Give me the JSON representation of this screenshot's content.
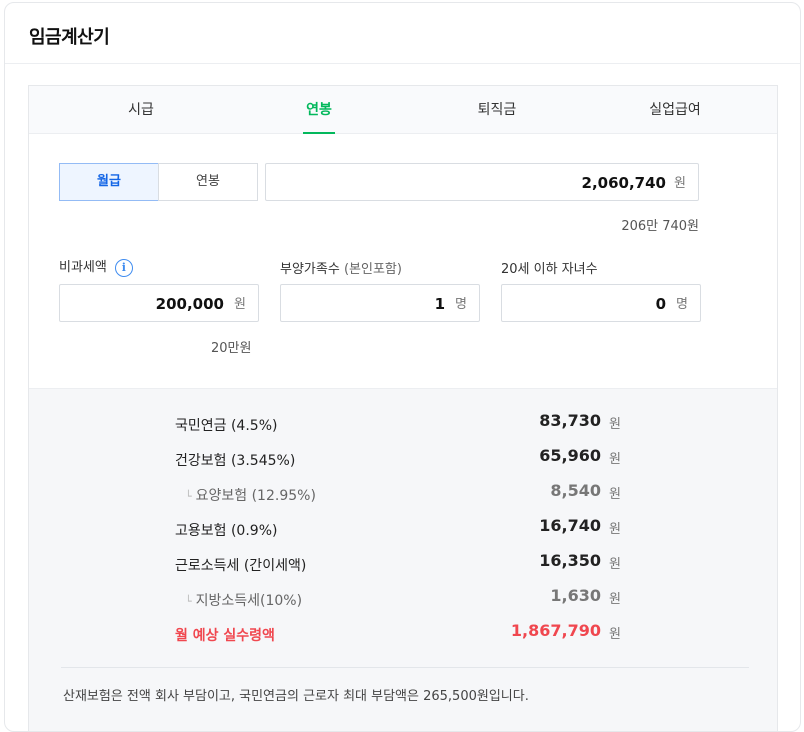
{
  "title": "임금계산기",
  "tabs": [
    {
      "label": "시급",
      "active": false
    },
    {
      "label": "연봉",
      "active": true
    },
    {
      "label": "퇴직금",
      "active": false
    },
    {
      "label": "실업급여",
      "active": false
    }
  ],
  "accent_color": "#03b85c",
  "negative_color": "#f0474f",
  "pay_type": {
    "options": [
      "월급",
      "연봉"
    ],
    "selected": "월급"
  },
  "salary": {
    "value": "2,060,740",
    "unit": "원",
    "korean": "206만 740원"
  },
  "non_taxable": {
    "label": "비과세액",
    "info_icon": "i",
    "value": "200,000",
    "unit": "원",
    "korean": "20만원"
  },
  "dependents": {
    "label": "부양가족수",
    "note": "(본인포함)",
    "value": "1",
    "unit": "명"
  },
  "children": {
    "label": "20세 이하 자녀수",
    "value": "0",
    "unit": "명"
  },
  "deductions": [
    {
      "label": "국민연금 (4.5%)",
      "amount": "83,730",
      "unit": "원",
      "sub": false
    },
    {
      "label": "건강보험 (3.545%)",
      "amount": "65,960",
      "unit": "원",
      "sub": false
    },
    {
      "label": "요양보험 (12.95%)",
      "amount": "8,540",
      "unit": "원",
      "sub": true
    },
    {
      "label": "고용보험 (0.9%)",
      "amount": "16,740",
      "unit": "원",
      "sub": false
    },
    {
      "label": "근로소득세 (간이세액)",
      "amount": "16,350",
      "unit": "원",
      "sub": false
    },
    {
      "label": "지방소득세(10%)",
      "amount": "1,630",
      "unit": "원",
      "sub": true
    }
  ],
  "net_pay": {
    "label": "월 예상 실수령액",
    "amount": "1,867,790",
    "unit": "원"
  },
  "sub_marker": "└",
  "footnote": "산재보험은 전액 회사 부담이고, 국민연금의 근로자 최대 부담액은 265,500원입니다."
}
